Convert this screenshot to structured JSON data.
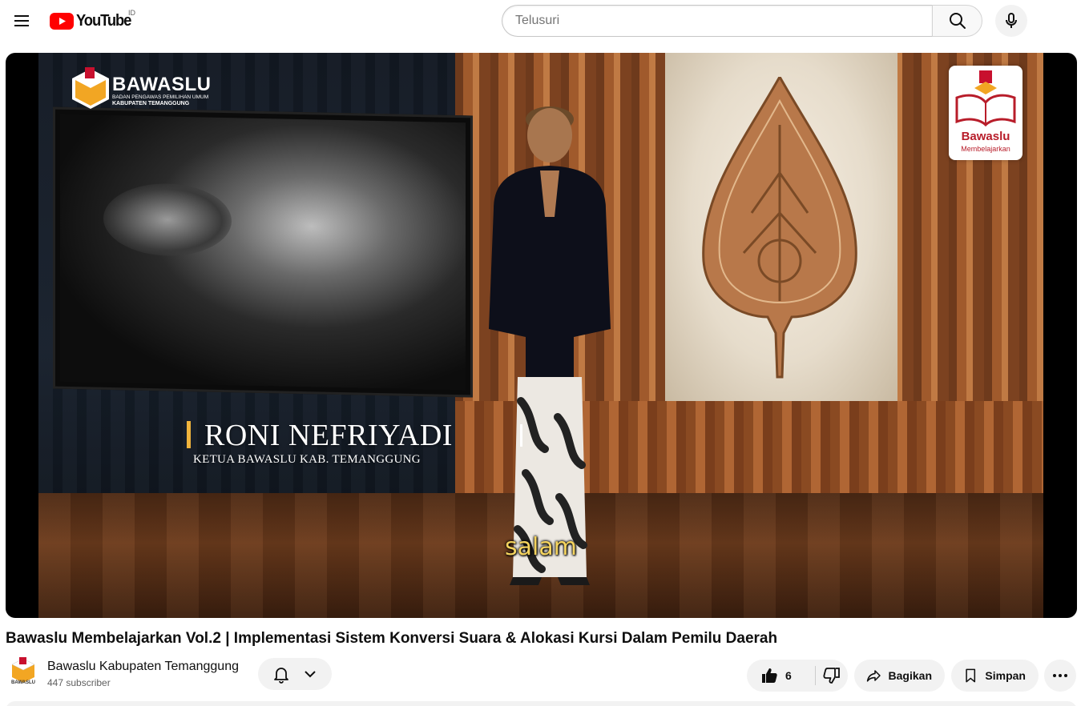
{
  "header": {
    "logo_text": "YouTube",
    "country_code": "ID",
    "search_placeholder": "Telusuri",
    "icons": {
      "menu": "hamburger-icon",
      "search": "search-icon",
      "mic": "microphone-icon"
    }
  },
  "player": {
    "overlay_logo_title": "BAWASLU",
    "overlay_logo_sub1": "BADAN PENGAWAS PEMILIHAN UMUM",
    "overlay_logo_sub2": "KABUPATEN TEMANGGUNG",
    "corner_badge_name": "Bawaslu",
    "corner_badge_sub": "Membelajarkan",
    "lower_third_name": "RONI NEFRIYADI",
    "lower_third_role": "KETUA BAWASLU KAB. TEMANGGUNG",
    "caption": "salam"
  },
  "video": {
    "title": "Bawaslu Membelajarkan Vol.2 | Implementasi Sistem Konversi Suara & Alokasi Kursi Dalam Pemilu Daerah"
  },
  "channel": {
    "name": "Bawaslu Kabupaten Temanggung",
    "subscribers": "447 subscriber",
    "avatar_text": "BAWASLU"
  },
  "actions": {
    "like_count": "6",
    "share_label": "Bagikan",
    "save_label": "Simpan"
  },
  "colors": {
    "brand_red": "#ff0000",
    "bawaslu_red": "#b81d2a",
    "caption_yellow": "#f4d35e",
    "pill_bg": "#f2f2f2"
  }
}
